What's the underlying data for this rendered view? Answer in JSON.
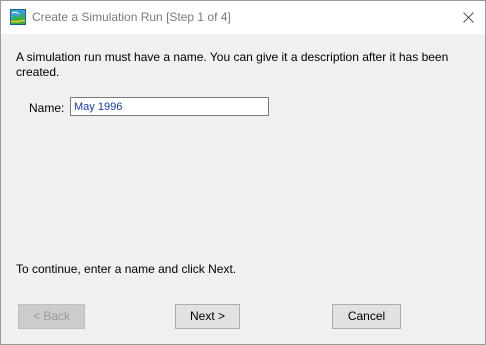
{
  "window": {
    "title": "Create a Simulation Run [Step 1 of 4]",
    "app_icon": "terrain-map-icon",
    "close_icon": "close-icon"
  },
  "main": {
    "instructions": "A simulation run must have a name. You can give it a description after it has been created.",
    "name_label": "Name:",
    "name_value": "May 1996",
    "continue_text": "To continue, enter a name and click Next."
  },
  "buttons": {
    "back_label": "< Back",
    "back_enabled": false,
    "next_label": "Next >",
    "cancel_label": "Cancel"
  },
  "colors": {
    "input_text": "#1a3a9a",
    "window_bg": "#f0f0f0",
    "button_bg": "#e1e1e1"
  }
}
